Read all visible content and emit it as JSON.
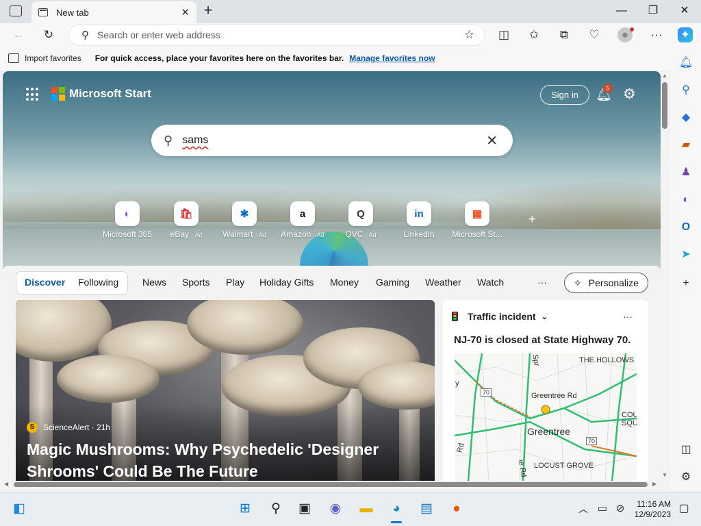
{
  "browser": {
    "tab_title": "New tab",
    "tab_close": "✕",
    "new_tab": "+",
    "window": {
      "minimize": "—",
      "restore": "❐",
      "close": "✕"
    },
    "address_placeholder": "Search or enter web address",
    "favorites_bar": {
      "import_label": "Import favorites",
      "message": "For quick access, place your favorites here on the favorites bar.",
      "manage_link": "Manage favorites now"
    }
  },
  "start_page": {
    "brand": "Microsoft Start",
    "sign_in": "Sign in",
    "notification_count": "5",
    "search_value": "sams",
    "quick_links": [
      {
        "label": "Microsoft 365",
        "ad": "",
        "glyph": "◐",
        "color": "#7b4fd6"
      },
      {
        "label": "eBay",
        "ad": "· Ad",
        "glyph": "🛍",
        "color": "#e53238"
      },
      {
        "label": "Walmart",
        "ad": "· Ad",
        "glyph": "✱",
        "color": "#0071ce"
      },
      {
        "label": "Amazon",
        "ad": "· Ad",
        "glyph": "a",
        "color": "#111111"
      },
      {
        "label": "QVC",
        "ad": "· Ad",
        "glyph": "Q",
        "color": "#333333"
      },
      {
        "label": "LinkedIn",
        "ad": "",
        "glyph": "in",
        "color": "#0a66c2"
      },
      {
        "label": "Microsoft St...",
        "ad": "",
        "glyph": "▦",
        "color": "#f25022"
      }
    ],
    "add_tile": "+",
    "feed_tabs": [
      "Discover",
      "Following",
      "News",
      "Sports",
      "Play",
      "Holiday Gifts",
      "Money",
      "Gaming",
      "Weather",
      "Watch"
    ],
    "more_tabs": "···",
    "personalize": "Personalize",
    "article": {
      "source": "ScienceAlert · 21h",
      "source_logo": "S",
      "headline": "Magic Mushrooms: Why Psychedelic 'Designer Shrooms' Could Be The Future"
    },
    "traffic": {
      "title": "Traffic incident",
      "more": "···",
      "description": "NJ-70 is closed at State Highway 70.",
      "map_labels": {
        "hollows": "THE HOLLOWS",
        "greentree_rd": "Greentree Rd",
        "greentree": "Greentree",
        "locust": "LOCUST GROVE",
        "cou": "COU",
        "squ": "SQU",
        "route1": "70",
        "route2": "70",
        "spr": "Spr",
        "rd": "Rd",
        "ie_rd": "ie Rd",
        "y": "y"
      }
    }
  },
  "taskbar": {
    "time": "11:16 AM",
    "date": "12/9/2023"
  },
  "colors": {
    "accent": "#0b5cad",
    "traffic_road": "#2fbf71",
    "closure": "#e0782a"
  }
}
